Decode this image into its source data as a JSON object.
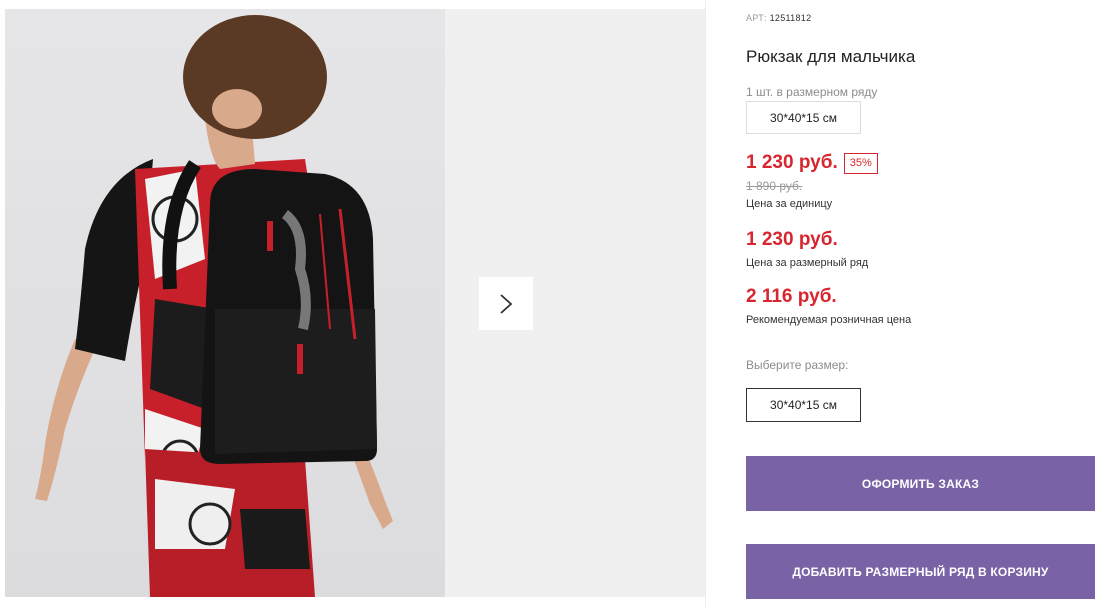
{
  "product": {
    "sku_label": "АРТ:",
    "sku_value": "12511812",
    "title": "Рюкзак для мальчика",
    "qty_note": "1 шт. в размерном ряду",
    "size_chip": "30*40*15 см"
  },
  "pricing": {
    "unit_price": "1 230 руб.",
    "discount_badge": "35%",
    "old_price": "1 890 руб.",
    "unit_caption": "Цена за единицу",
    "row_price": "1 230 руб.",
    "row_caption": "Цена за размерный ряд",
    "retail_price": "2 116 руб.",
    "retail_caption": "Рекомендуемая розничная цена"
  },
  "size_select": {
    "label": "Выберите размер:",
    "value": "30*40*15 см"
  },
  "actions": {
    "order_label": "ОФОРМИТЬ ЗАКАЗ",
    "add_row_label": "ДОБАВИТЬ РАЗМЕРНЫЙ РЯД В КОРЗИНУ"
  },
  "colors": {
    "accent": "#7a62a6",
    "price": "#d7262f"
  }
}
